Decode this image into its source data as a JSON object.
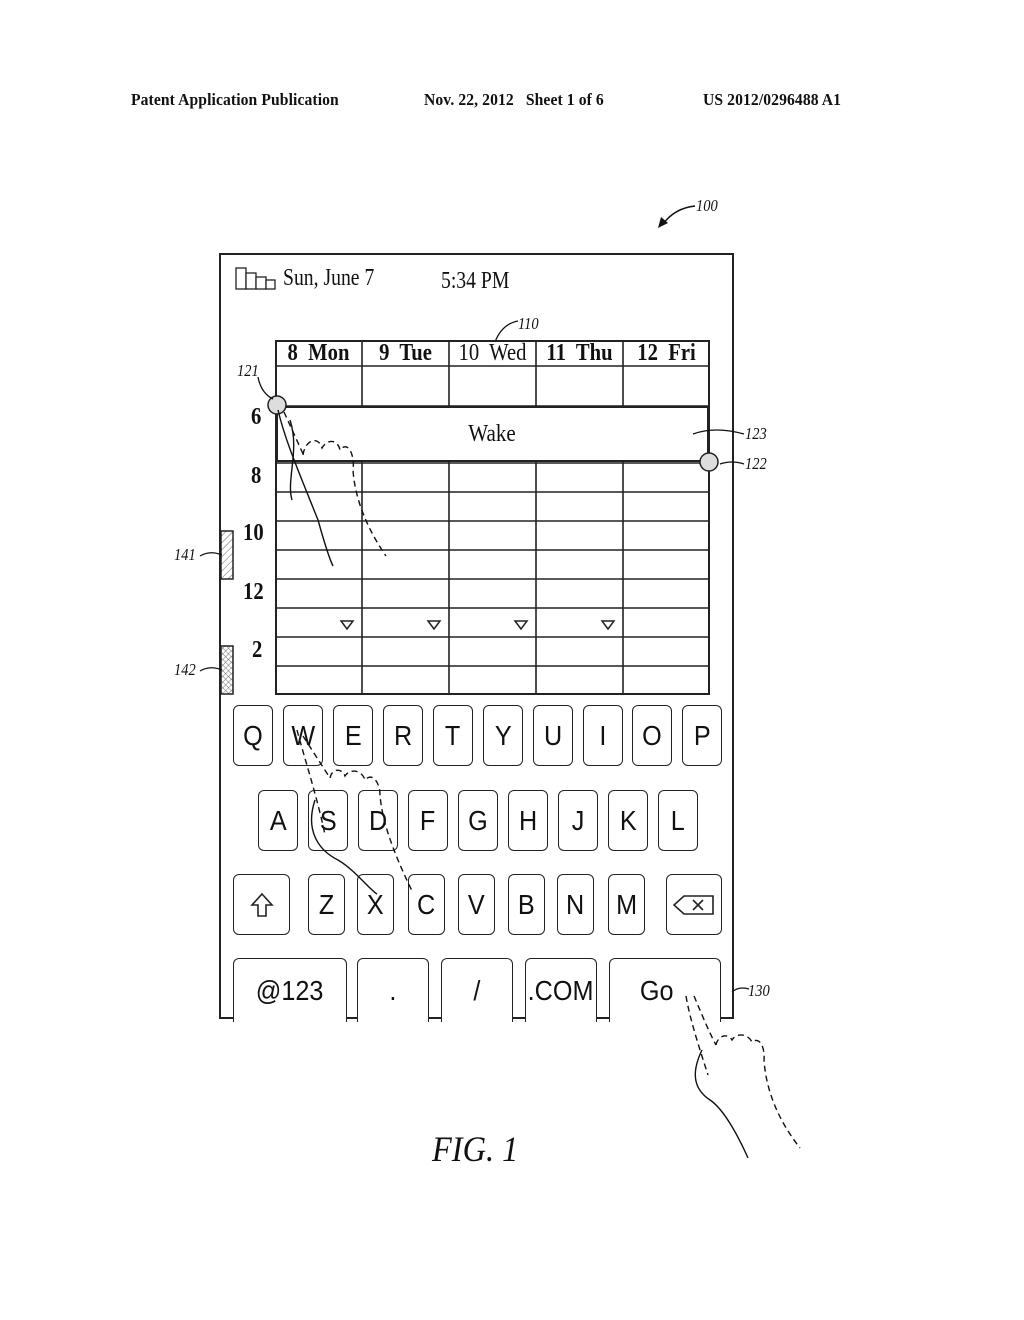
{
  "header": {
    "publication": "Patent Application Publication",
    "date_sheet": "Nov. 22, 2012   Sheet 1 of 6",
    "patent_number": "US 2012/0296488 A1"
  },
  "references": {
    "device": "100",
    "calendar": "110",
    "handle_start": "121",
    "handle_end": "122",
    "event_block": "123",
    "keyboard": "130",
    "scroll_indicator_1": "141",
    "scroll_indicator_2": "142"
  },
  "status_bar": {
    "battery_icon": "battery-bars-icon",
    "date": "Sun, June 7",
    "time": "5:34 PM"
  },
  "calendar": {
    "days": [
      "8  Mon",
      "9  Tue",
      "10  Wed",
      "11  Thu",
      "12  Fri"
    ],
    "hours": [
      "6",
      "8",
      "10",
      "12",
      "2"
    ],
    "event": {
      "title": "Wake"
    },
    "more_indicator_icon": "triangle-down-icon"
  },
  "keyboard": {
    "row1": [
      "Q",
      "W",
      "E",
      "R",
      "T",
      "Y",
      "U",
      "I",
      "O",
      "P"
    ],
    "row2": [
      "A",
      "S",
      "D",
      "F",
      "G",
      "H",
      "J",
      "K",
      "L"
    ],
    "row3": {
      "shift_icon": "shift-arrow-icon",
      "letters": [
        "Z",
        "X",
        "C",
        "V",
        "B",
        "N",
        "M"
      ],
      "backspace_icon": "backspace-icon"
    },
    "row4": [
      "@123",
      ".",
      "/",
      ".COM",
      "Go"
    ]
  },
  "figure_label": "FIG. 1"
}
